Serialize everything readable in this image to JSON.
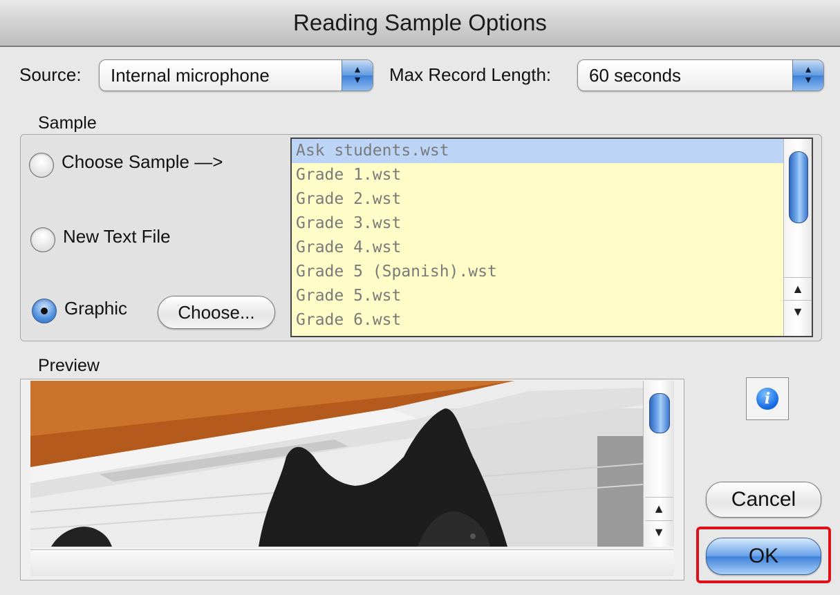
{
  "window": {
    "title": "Reading Sample Options"
  },
  "source": {
    "label": "Source:",
    "value": "Internal microphone"
  },
  "max_record": {
    "label": "Max Record Length:",
    "value": "60 seconds"
  },
  "sample": {
    "label": "Sample",
    "options": [
      {
        "label": "Choose Sample —>",
        "selected": false
      },
      {
        "label": "New Text File",
        "selected": false
      },
      {
        "label": "Graphic",
        "selected": true
      }
    ],
    "choose_button": "Choose...",
    "files": [
      "Ask students.wst",
      "Grade 1.wst",
      "Grade 2.wst",
      "Grade 3.wst",
      "Grade 4.wst",
      "Grade 5 (Spanish).wst",
      "Grade 5.wst",
      "Grade 6.wst"
    ],
    "selected_file": "Ask students.wst"
  },
  "preview": {
    "label": "Preview"
  },
  "buttons": {
    "cancel": "Cancel",
    "ok": "OK"
  },
  "icons": {
    "info": "info-icon",
    "popup_arrows": "up-down-arrows-icon",
    "scroll_up": "scroll-up-arrow-icon",
    "scroll_down": "scroll-down-arrow-icon"
  },
  "colors": {
    "list_background": "#fffdc7",
    "selection": "#bcd4f5",
    "accent_blue": "#3f82dc",
    "highlight_box": "#e0101a"
  }
}
